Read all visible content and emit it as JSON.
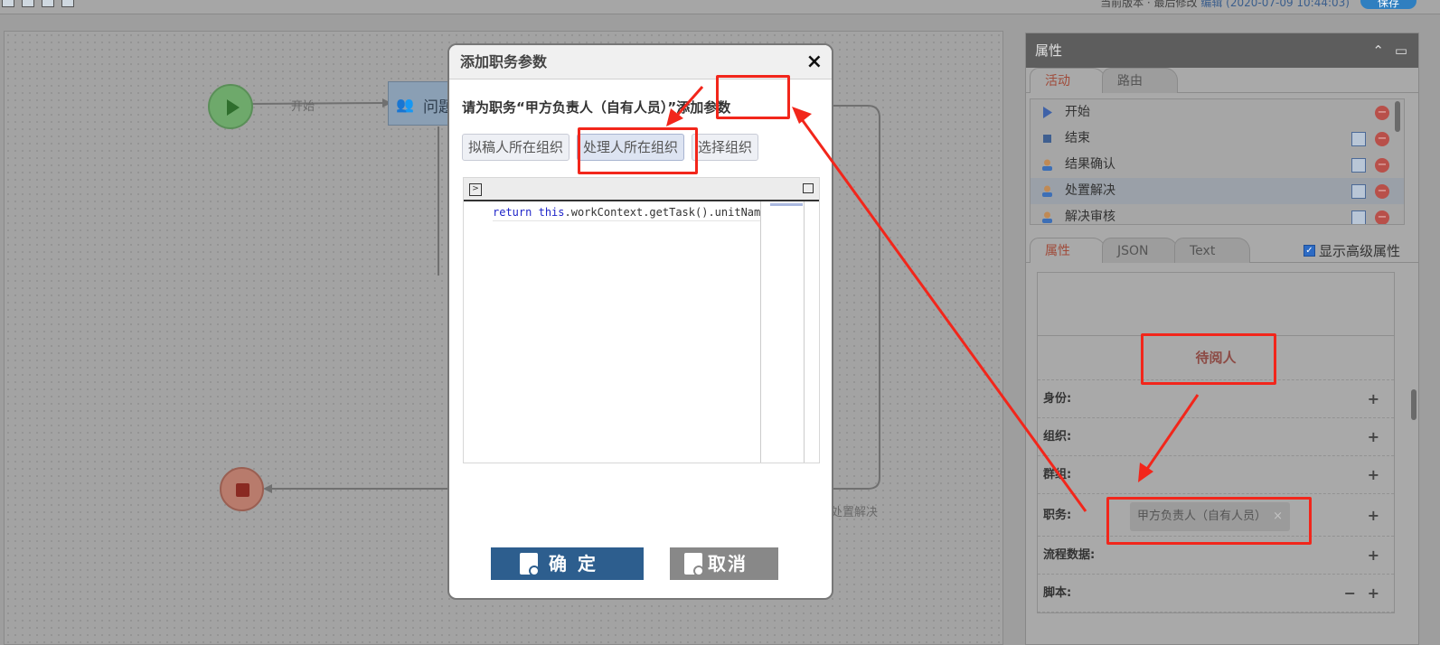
{
  "topbar": {
    "status_text": "当前版本 · 最后修改",
    "status_link": "编辑 (2020-07-09 10:44:03)",
    "button_label": "保存"
  },
  "canvas": {
    "start_edge_label": "开始",
    "activity_label": "问题",
    "bottom_edge_label": "处置解决"
  },
  "dialog": {
    "title": "添加职务参数",
    "close": "×",
    "prompt_prefix": "请为职务“甲方负责人（自有人员）”",
    "prompt_action": "添加参数",
    "org_buttons": [
      "拟稿人所在组织",
      "处理人所在组织",
      "选择组织"
    ],
    "code_keyword_return": "return",
    "code_keyword_this": "this",
    "code_rest": ".workContext.getTask().unitName;",
    "ok_label": "确定",
    "cancel_label": "取消"
  },
  "right_panel": {
    "title": "属性",
    "tabs_top": [
      "活动",
      "路由"
    ],
    "activities": [
      {
        "label": "开始",
        "icon": "start-icon"
      },
      {
        "label": "结束",
        "icon": "end-icon"
      },
      {
        "label": "结果确认",
        "icon": "user-icon"
      },
      {
        "label": "处置解决",
        "icon": "user-icon"
      },
      {
        "label": "解决审核",
        "icon": "user-icon"
      }
    ],
    "tabs_bottom": [
      "属性",
      "JSON",
      "Text"
    ],
    "advanced_label": "显示高级属性",
    "section_title": "待阅人",
    "rows": {
      "identity": "身份:",
      "org": "组织:",
      "group": "群组:",
      "duty": "职务:",
      "flow_data": "流程数据:",
      "script": "脚本:"
    },
    "duty_chip": "甲方负责人（自有人员）",
    "chip_close": "×",
    "plus": "+",
    "minus": "−"
  },
  "colors": {
    "annotation": "#f2261b",
    "ok_button": "#2d5e8e",
    "section_title": "#8c4a44",
    "active_tab": "#a04b3a"
  }
}
